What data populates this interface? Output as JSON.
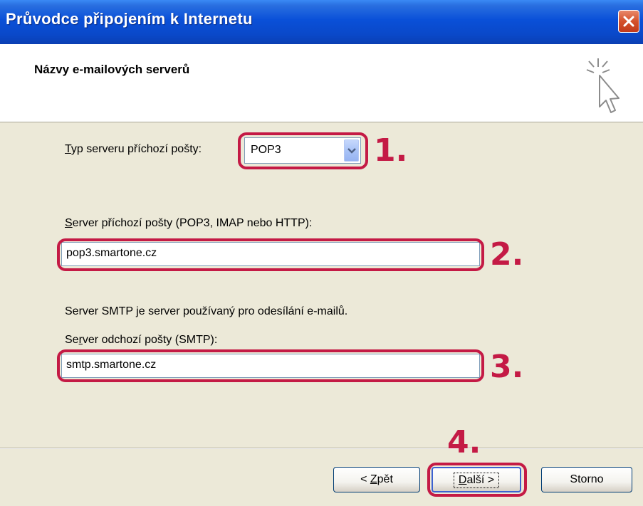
{
  "window": {
    "title": "Průvodce připojením k Internetu"
  },
  "header": {
    "title": "Názvy e-mailových serverů"
  },
  "form": {
    "incoming_type_label_mnemonic": "T",
    "incoming_type_label_rest": "yp serveru příchozí pošty:",
    "incoming_type_value": "POP3",
    "incoming_server_label_mnemonic": "S",
    "incoming_server_label_rest": "erver příchozí pošty (POP3, IMAP nebo HTTP):",
    "incoming_server_value": "pop3.smartone.cz",
    "smtp_info": "Server SMTP je server používaný pro odesílání e-mailů.",
    "outgoing_server_label_pre": "Se",
    "outgoing_server_label_mnemonic": "r",
    "outgoing_server_label_rest": "ver odchozí pošty (SMTP):",
    "outgoing_server_value": "smtp.smartone.cz"
  },
  "annotations": {
    "step1": "1.",
    "step2": "2.",
    "step3": "3.",
    "step4": "4."
  },
  "buttons": {
    "back_pre": "< ",
    "back_mnemonic": "Z",
    "back_rest": "pět",
    "next_mnemonic": "D",
    "next_rest": "alší >",
    "cancel": "Storno"
  },
  "colors": {
    "annotation_red": "#c41a45",
    "titlebar_blue": "#0a50d8",
    "dialog_bg": "#ece9d8"
  }
}
